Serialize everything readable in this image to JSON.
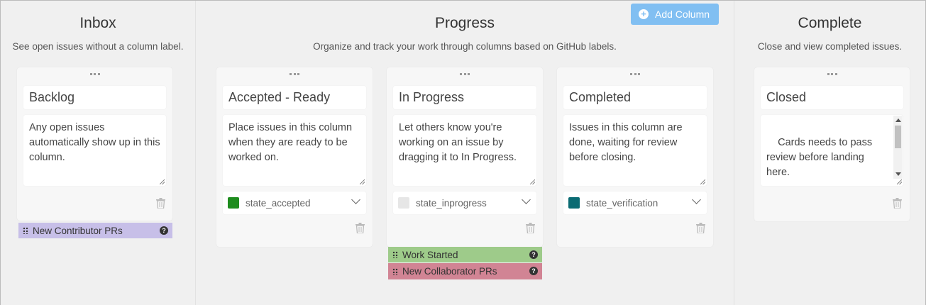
{
  "add_column_label": "Add Column",
  "sections": {
    "inbox": {
      "title": "Inbox",
      "subtitle": "See open issues without a column label."
    },
    "progress": {
      "title": "Progress",
      "subtitle": "Organize and track your work through columns based on GitHub labels."
    },
    "complete": {
      "title": "Complete",
      "subtitle": "Close and view completed issues."
    }
  },
  "columns": {
    "backlog": {
      "name": "Backlog",
      "description": "Any open issues automatically show up in this column."
    },
    "accepted": {
      "name": "Accepted - Ready",
      "description": "Place issues in this column when they are ready to be worked on.",
      "label": "state_accepted",
      "label_color": "#1e8c1e"
    },
    "inprogress": {
      "name": "In Progress",
      "description": "Let others know you're working on an issue by dragging it to In Progress.",
      "label": "state_inprogress",
      "label_color": "#e6e6e6"
    },
    "completed": {
      "name": "Completed",
      "description": "Issues in this column are done, waiting for review before closing.",
      "label": "state_verification",
      "label_color": "#0a6b73"
    },
    "closed": {
      "name": "Closed",
      "description": "Cards needs to pass review before landing here.\n\nIssues closed in the last"
    }
  },
  "labels": {
    "new_contributor": {
      "text": "New Contributor PRs",
      "color": "#c7bfe8"
    },
    "work_started": {
      "text": "Work Started",
      "color": "#9ecb8a"
    },
    "new_collaborator": {
      "text": "New Collaborator PRs",
      "color": "#d18494"
    }
  }
}
